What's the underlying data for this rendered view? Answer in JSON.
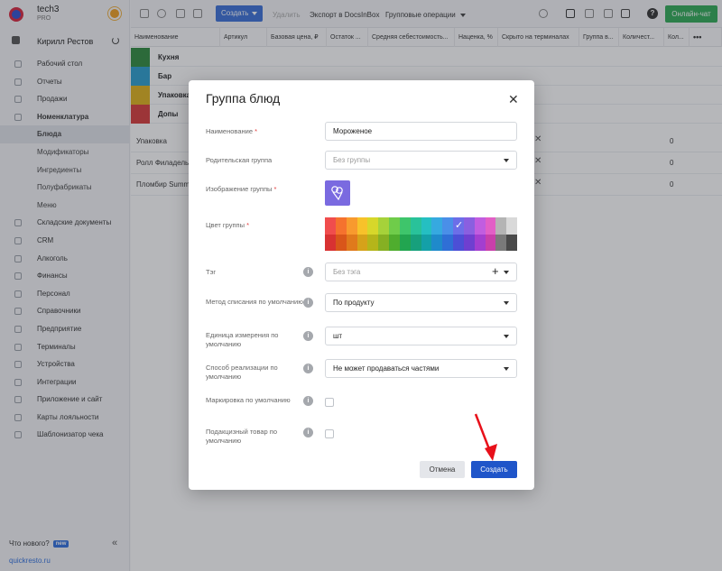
{
  "app": {
    "name": "tech3",
    "plan": "PRO",
    "user": "Кирилл Рестов"
  },
  "sidebar": {
    "items": [
      {
        "label": "Рабочий стол"
      },
      {
        "label": "Отчеты"
      },
      {
        "label": "Продажи"
      },
      {
        "label": "Номенклатура"
      },
      {
        "label": "Блюда"
      },
      {
        "label": "Модификаторы"
      },
      {
        "label": "Ингредиенты"
      },
      {
        "label": "Полуфабрикаты"
      },
      {
        "label": "Меню"
      },
      {
        "label": "Складские документы"
      },
      {
        "label": "CRM"
      },
      {
        "label": "Алкоголь"
      },
      {
        "label": "Финансы"
      },
      {
        "label": "Персонал"
      },
      {
        "label": "Справочники"
      },
      {
        "label": "Предприятие"
      },
      {
        "label": "Терминалы"
      },
      {
        "label": "Устройства"
      },
      {
        "label": "Интеграции"
      },
      {
        "label": "Приложение и сайт"
      },
      {
        "label": "Карты лояльности"
      },
      {
        "label": "Шаблонизатор чека"
      }
    ],
    "whats_new": "Что нового?",
    "new_badge": "new",
    "footer_link": "quickresto.ru"
  },
  "toolbar": {
    "create": "Создать",
    "delete": "Удалить",
    "export": "Экспорт в DocsInBox",
    "group_ops": "Групповые операции",
    "online_chat": "Онлайн-чат",
    "help": "?"
  },
  "grid": {
    "columns": [
      "Наименование",
      "Артикул",
      "Базовая цена, ₽",
      "Остаток ...",
      "Средняя себестоимость...",
      "Наценка, %",
      "Скрыто на терминалах",
      "Группа в...",
      "Количест...",
      "Кол...",
      "•••"
    ],
    "groups": [
      {
        "label": "Кухня",
        "color": "#2e8b3e"
      },
      {
        "label": "Бар",
        "color": "#2a9fcf"
      },
      {
        "label": "Упаковка",
        "color": "#e0b21a"
      },
      {
        "label": "Допы",
        "color": "#d83a3a"
      }
    ],
    "rows": [
      {
        "name": "Упаковка",
        "hidden": "✕",
        "qty": "0"
      },
      {
        "name": "Ролл Филадельф...",
        "hidden": "✕",
        "qty": "0"
      },
      {
        "name": "Пломбир Summit...",
        "hidden": "✕",
        "qty": "0"
      }
    ]
  },
  "modal": {
    "title": "Группа блюд",
    "close": "✕",
    "fields": {
      "name_label": "Наименование",
      "name_value": "Мороженое",
      "parent_label": "Родительская группа",
      "parent_placeholder": "Без группы",
      "image_label": "Изображение группы",
      "color_label": "Цвет группы",
      "tag_label": "Тэг",
      "tag_placeholder": "Без тэга",
      "writeoff_label": "Метод списания по умолчанию",
      "writeoff_value": "По продукту",
      "unit_label": "Единица измерения по умолчанию",
      "unit_value": "шт",
      "sale_label": "Способ реализации по умолчанию",
      "sale_value": "Не может продаваться частями",
      "marking_label": "Маркировка по умолчанию",
      "excise_label": "Подакцизный товар по умолчанию"
    },
    "required_mark": "*",
    "info_mark": "i",
    "plus": "+",
    "checkmark": "✓",
    "palette_top": [
      "#f04d4d",
      "#f5722e",
      "#f89a2e",
      "#f7c22a",
      "#d7d72a",
      "#a6d23a",
      "#6fcc4a",
      "#3ec56b",
      "#29c29a",
      "#25bfc2",
      "#36a9e0",
      "#4a8fe8",
      "#6c6ee8",
      "#8a5fe0",
      "#c15de0",
      "#e25fc6",
      "#b4b4b4",
      "#d9d9d9"
    ],
    "palette_bottom": [
      "#d83232",
      "#d9561a",
      "#e07a1c",
      "#d6a21a",
      "#b5b51a",
      "#86b023",
      "#4fad2e",
      "#22a550",
      "#17a07c",
      "#14a0a8",
      "#1f8acb",
      "#2f6fd6",
      "#4c4fd6",
      "#6f3fd0",
      "#a33ed0",
      "#c83faa",
      "#7a7a7a",
      "#4a4a4a"
    ],
    "selected_color": "#6c6ee8",
    "cancel": "Отмена",
    "submit": "Создать"
  },
  "annotation": {
    "arrow_color": "#e8101a"
  }
}
